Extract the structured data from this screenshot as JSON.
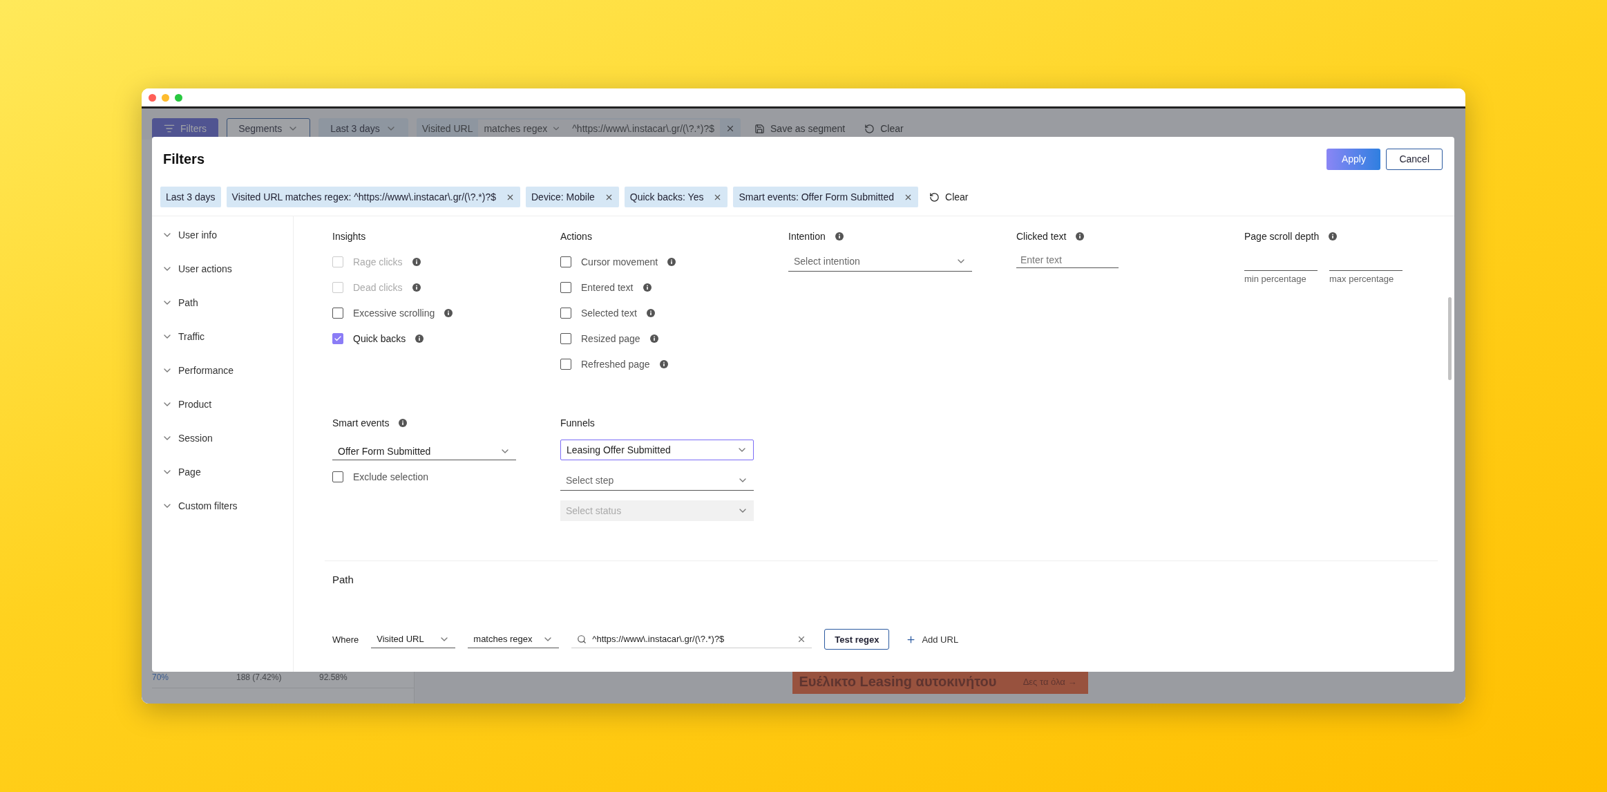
{
  "app_toolbar": {
    "filters_button": "Filters",
    "segments_button": "Segments",
    "date_range": "Last 3 days",
    "url_filter": {
      "field": "Visited URL",
      "operator": "matches regex",
      "value": "^https://www\\.instacar\\.gr/(\\?.*)?$"
    },
    "save_segment": "Save as segment",
    "clear": "Clear"
  },
  "background": {
    "table_row": [
      "70%",
      "188 (7.42%)",
      "92.58%"
    ],
    "banner": {
      "title": "Ευέλικτο Leasing αυτοκινήτου",
      "link": "Δες τα όλα →"
    }
  },
  "modal": {
    "title": "Filters",
    "apply": "Apply",
    "cancel": "Cancel",
    "chips": [
      {
        "label": "Last 3 days",
        "removable": false
      },
      {
        "label": "Visited URL matches regex: ^https://www\\.instacar\\.gr/(\\?.*)?$",
        "removable": true
      },
      {
        "label": "Device: Mobile",
        "removable": true
      },
      {
        "label": "Quick backs: Yes",
        "removable": true
      },
      {
        "label": "Smart events: Offer Form Submitted",
        "removable": true
      }
    ],
    "clear": "Clear",
    "sidebar": [
      "User info",
      "User actions",
      "Path",
      "Traffic",
      "Performance",
      "Product",
      "Session",
      "Page",
      "Custom filters"
    ],
    "insights": {
      "title": "Insights",
      "info": false,
      "items": [
        {
          "label": "Rage clicks",
          "checked": false,
          "disabled": true
        },
        {
          "label": "Dead clicks",
          "checked": false,
          "disabled": true
        },
        {
          "label": "Excessive scrolling",
          "checked": false,
          "disabled": false
        },
        {
          "label": "Quick backs",
          "checked": true,
          "disabled": false
        }
      ]
    },
    "actions": {
      "title": "Actions",
      "info": false,
      "items": [
        {
          "label": "Cursor movement",
          "checked": false,
          "disabled": false
        },
        {
          "label": "Entered text",
          "checked": false,
          "disabled": false
        },
        {
          "label": "Selected text",
          "checked": false,
          "disabled": false
        },
        {
          "label": "Resized page",
          "checked": false,
          "disabled": false
        },
        {
          "label": "Refreshed page",
          "checked": false,
          "disabled": false
        }
      ]
    },
    "intention": {
      "title": "Intention",
      "info": true,
      "placeholder": "Select intention"
    },
    "clicked_text": {
      "title": "Clicked text",
      "info": true,
      "placeholder": "Enter text"
    },
    "scroll_depth": {
      "title": "Page scroll depth",
      "info": true,
      "min_label": "min percentage",
      "max_label": "max percentage"
    },
    "smart_events": {
      "title": "Smart events",
      "info": true,
      "value": "Offer Form Submitted",
      "exclude": {
        "label": "Exclude selection",
        "checked": false,
        "disabled": false
      }
    },
    "funnels": {
      "title": "Funnels",
      "info": false,
      "value": "Leasing Offer Submitted",
      "focused": true,
      "step_placeholder": "Select step",
      "status_placeholder": "Select status",
      "status_disabled": true
    },
    "path": {
      "title": "Path",
      "where": "Where",
      "field": "Visited URL",
      "operator": "matches regex",
      "value": "^https://www\\.instacar\\.gr/(\\?.*)?$",
      "test_button": "Test regex",
      "add_button": "Add URL"
    }
  }
}
